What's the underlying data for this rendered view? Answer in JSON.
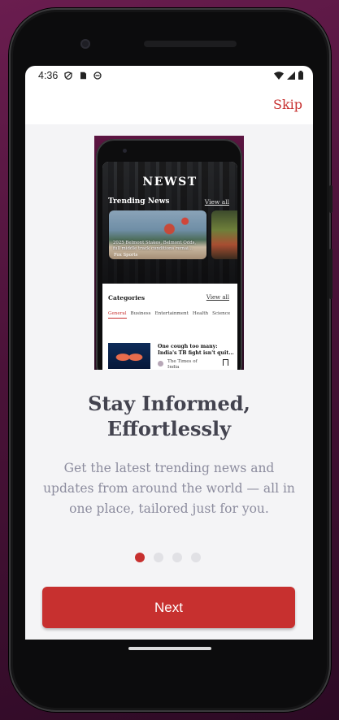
{
  "status_bar": {
    "time": "4:36",
    "left_icons": [
      "shield-icon",
      "sim-card-icon",
      "face-icon"
    ],
    "right_icons": [
      "wifi-icon",
      "signal-icon",
      "battery-icon"
    ]
  },
  "top_bar": {
    "skip_label": "Skip"
  },
  "preview": {
    "app_name": "NEWST",
    "trending_title": "Trending News",
    "trending_view_all": "View all",
    "trending_card": {
      "caption": "2025 Belmont Stakes, Belmont Odds, full middle track conditions remai...",
      "source": "Fox Sports"
    },
    "categories_title": "Categories",
    "categories_view_all": "View all",
    "category_tabs": [
      "General",
      "Business",
      "Entertainment",
      "Health",
      "Science"
    ],
    "active_category": "General",
    "article": {
      "title": "One cough too many: India's TB fight isn't quit...",
      "source": "The Times of India"
    }
  },
  "onboarding": {
    "headline_line1": "Stay Informed,",
    "headline_line2": "Effortlessly",
    "description": "Get the latest trending news and updates from around the world — all in one place, tailored just for you.",
    "page_count": 4,
    "active_page": 1,
    "next_label": "Next"
  },
  "colors": {
    "accent": "#c7302f",
    "headline": "#43434f",
    "body_text": "#8c8c9e",
    "background": "#f4f4f6"
  }
}
